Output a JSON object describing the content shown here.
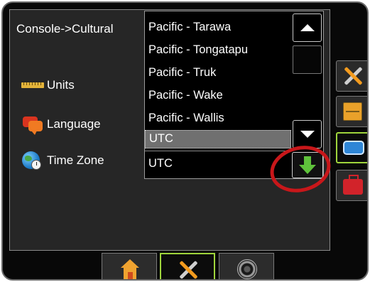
{
  "breadcrumb": "Console->Cultural",
  "menu": {
    "items": [
      {
        "label": "Units",
        "icon": "ruler-icon"
      },
      {
        "label": "Language",
        "icon": "speech-bubbles-icon"
      },
      {
        "label": "Time Zone",
        "icon": "globe-clock-icon"
      }
    ]
  },
  "timezone_dropdown": {
    "options": [
      "Pacific - Tarawa",
      "Pacific - Tongatapu",
      "Pacific - Truk",
      "Pacific - Wake",
      "Pacific - Wallis",
      "UTC"
    ],
    "selected_option": "UTC",
    "current_value": "UTC"
  },
  "side_tabs": [
    {
      "name": "tools-tab",
      "icon": "tools-icon",
      "active": false
    },
    {
      "name": "drawer-tab",
      "icon": "drawer-icon",
      "active": false
    },
    {
      "name": "screen-tab",
      "icon": "screen-icon",
      "active": true
    },
    {
      "name": "toolbox-tab",
      "icon": "toolbox-icon",
      "active": false
    }
  ],
  "bottom_tabs": [
    {
      "name": "home-tab",
      "icon": "home-icon",
      "active": false
    },
    {
      "name": "tools-tab",
      "icon": "tools-icon",
      "active": true
    },
    {
      "name": "gauge-tab",
      "icon": "gauge-icon",
      "active": false
    }
  ],
  "colors": {
    "accent_active": "#9fd53c",
    "selected_row": "#707070",
    "highlight_ellipse": "#c8171a",
    "confirm_arrow": "#5fc23b"
  }
}
